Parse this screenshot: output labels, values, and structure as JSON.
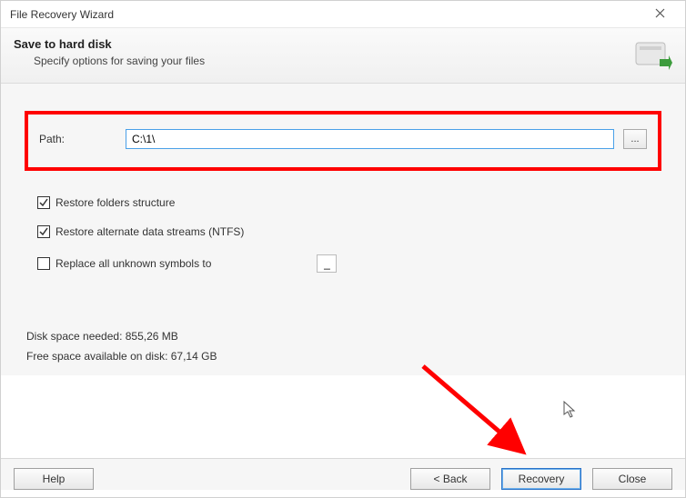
{
  "window": {
    "title": "File Recovery Wizard"
  },
  "header": {
    "title": "Save to hard disk",
    "subtitle": "Specify options for saving your files"
  },
  "path": {
    "label": "Path:",
    "value": "C:\\1\\",
    "browse": "..."
  },
  "options": {
    "restore_folders": {
      "label": "Restore folders structure",
      "checked": true
    },
    "restore_ads": {
      "label": "Restore alternate data streams (NTFS)",
      "checked": true
    },
    "replace_symbols": {
      "label": "Replace all unknown symbols to",
      "checked": false,
      "value": "_"
    }
  },
  "disk": {
    "needed": "Disk space needed: 855,26 MB",
    "free": "Free space available on disk: 67,14 GB"
  },
  "buttons": {
    "help": "Help",
    "back": "< Back",
    "recovery": "Recovery",
    "close": "Close"
  }
}
